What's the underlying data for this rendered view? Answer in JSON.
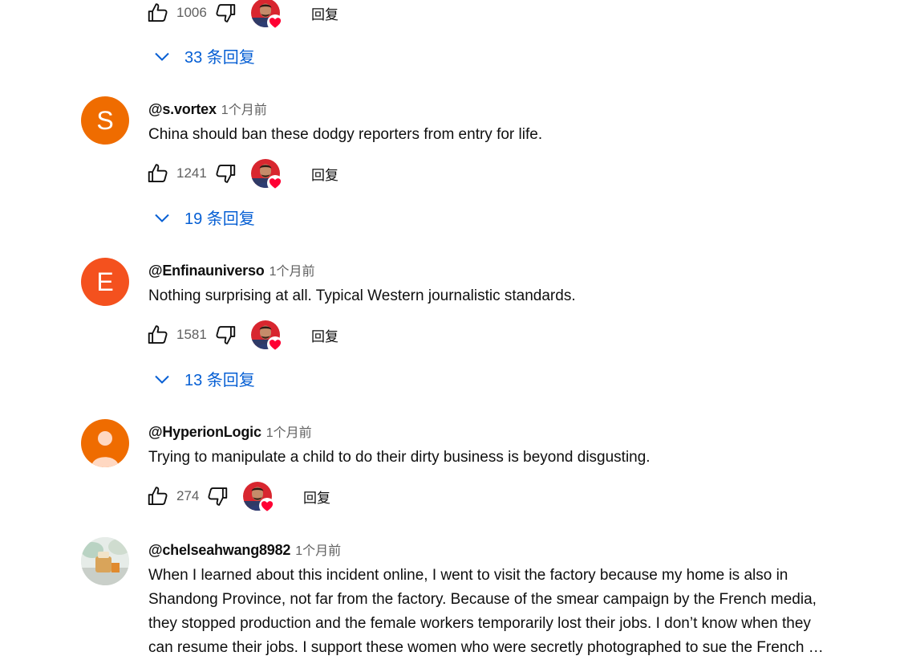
{
  "top": {
    "like_count": "1006",
    "reply_label": "回复"
  },
  "replies_toggles": [
    "33 条回复",
    "19 条回复",
    "13 条回复"
  ],
  "comments": [
    {
      "avatar_letter": "S",
      "avatar_color": "#ef6c00",
      "author": "@s.vortex",
      "time": "1个月前",
      "text": "China should ban these dodgy reporters from entry for life.",
      "like_count": "1241",
      "reply_label": "回复"
    },
    {
      "avatar_letter": "E",
      "avatar_color": "#f4511e",
      "author": "@Enfinauniverso",
      "time": "1个月前",
      "text": "Nothing surprising at all. Typical Western journalistic standards.",
      "like_count": "1581",
      "reply_label": "回复"
    },
    {
      "avatar_letter": "",
      "avatar_color": "#ef6c00",
      "author": "@HyperionLogic",
      "time": "1个月前",
      "text": "Trying to manipulate a child to do their dirty business is beyond disgusting.",
      "like_count": "274",
      "reply_label": "回复"
    },
    {
      "author": "@chelseahwang8982",
      "time": "1个月前",
      "text_lines": [
        "When I learned about this incident online, I went to visit the factory because my home is also in",
        "Shandong Province, not far from the factory. Because of the smear campaign by the French media,",
        "they stopped production and the female workers temporarily lost their jobs. I don’t know when they",
        "can resume their jobs. I support these women who were secretly photographed to sue the French …"
      ]
    }
  ],
  "colors": {
    "link_blue": "#065fd4",
    "meta_gray": "#606060",
    "heart_red": "#ff0033"
  }
}
